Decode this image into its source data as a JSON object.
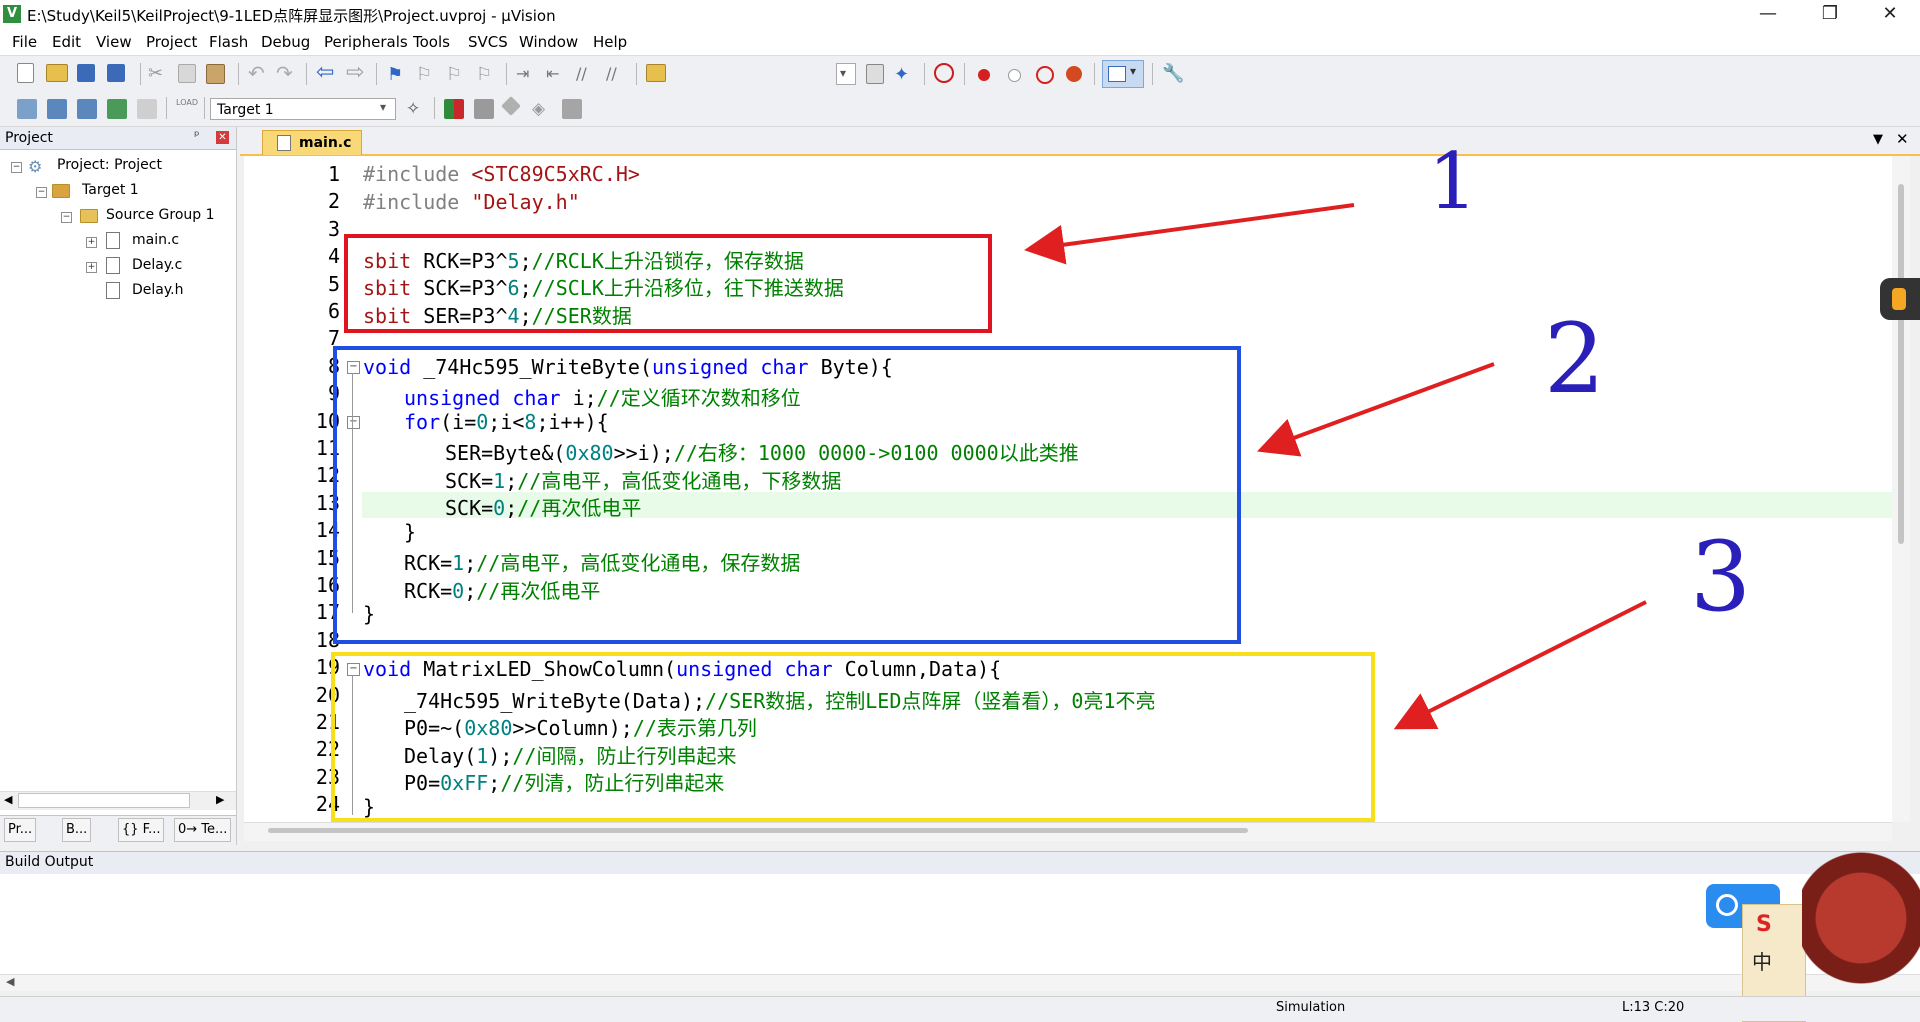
{
  "window": {
    "title": "E:\\Study\\Keil5\\KeilProject\\9-1LED点阵屏显示图形\\Project.uvproj - µVision",
    "app_icon": "V",
    "minimize_glyph": "—",
    "restore_glyph": "❐",
    "close_glyph": "✕"
  },
  "menu": [
    "File",
    "Edit",
    "View",
    "Project",
    "Flash",
    "Debug",
    "Peripherals",
    "Tools",
    "SVCS",
    "Window",
    "Help"
  ],
  "toolbar2": {
    "target": "Target 1",
    "load_label": "LOAD"
  },
  "project_panel": {
    "title": "Project",
    "pin_glyph": "ᵖ",
    "close_glyph": "✕",
    "tree": {
      "root": "Project: Project",
      "target": "Target 1",
      "group": "Source Group 1",
      "files": [
        "main.c",
        "Delay.c",
        "Delay.h"
      ]
    },
    "tabs": [
      "Pr...",
      "B...",
      "{} F...",
      "0→ Te..."
    ]
  },
  "editor": {
    "tab": "main.c",
    "line_numbers": [
      "1",
      "2",
      "3",
      "4",
      "5",
      "6",
      "7",
      "8",
      "9",
      "10",
      "11",
      "12",
      "13",
      "14",
      "15",
      "16",
      "17",
      "18",
      "19",
      "20",
      "21",
      "22",
      "23",
      "24"
    ]
  },
  "code": {
    "l1a": "#include ",
    "l1b": "<STC89C5xRC.H>",
    "l2a": "#include ",
    "l2b": "\"Delay.h\"",
    "l4a": "sbit ",
    "l4b": "RCK=P3^",
    "l4c": "5",
    "l4d": ";",
    "l4e": "//RCLK上升沿锁存，保存数据",
    "l5a": "sbit ",
    "l5b": "SCK=P3^",
    "l5c": "6",
    "l5d": ";",
    "l5e": "//SCLK上升沿移位，往下推送数据",
    "l6a": "sbit ",
    "l6b": "SER=P3^",
    "l6c": "4",
    "l6d": ";",
    "l6e": "//SER数据",
    "l8a": "void",
    "l8b": " _74Hc595_WriteByte(",
    "l8c": "unsigned char",
    "l8d": " Byte){",
    "l9a": "unsigned char",
    "l9b": " i;",
    "l9c": "//定义循环次数和移位",
    "l10a": "for",
    "l10b": "(i=",
    "l10c": "0",
    "l10d": ";i<",
    "l10e": "8",
    "l10f": ";i++){",
    "l11a": "SER=Byte&(",
    "l11b": "0x80",
    "l11c": ">>i);",
    "l11d": "//右移：1000 0000->0100 0000以此类推",
    "l12a": "SCK=",
    "l12b": "1",
    "l12c": ";",
    "l12d": "//高电平，高低变化通电，下移数据",
    "l13a": "SCK=",
    "l13b": "0",
    "l13c": ";",
    "l13d": "//再次低电平",
    "l14": "}",
    "l15a": "RCK=",
    "l15b": "1",
    "l15c": ";",
    "l15d": "//高电平，高低变化通电，保存数据",
    "l16a": "RCK=",
    "l16b": "0",
    "l16c": ";",
    "l16d": "//再次低电平",
    "l17": "}",
    "l19a": "void",
    "l19b": " MatrixLED_ShowColumn(",
    "l19c": "unsigned char",
    "l19d": " Column,Data){",
    "l20a": "_74Hc595_WriteByte(Data);",
    "l20b": "//SER数据，控制LED点阵屏（竖着看），0亮1不亮",
    "l21a": "P0=~(",
    "l21b": "0x80",
    "l21c": ">>Column);",
    "l21d": "//表示第几列",
    "l22a": "Delay(",
    "l22b": "1",
    "l22c": ");",
    "l22d": "//间隔，防止行列串起来",
    "l23a": "P0=",
    "l23b": "0xFF",
    "l23c": ";",
    "l23d": "//列清，防止行列串起来",
    "l24": "}"
  },
  "annotations": {
    "n1": "1",
    "n2": "2",
    "n3": "3"
  },
  "build_output": {
    "title": "Build Output"
  },
  "status": {
    "mode": "Simulation",
    "position": "L:13 C:20"
  },
  "colors": {
    "red_box": "#e0141e",
    "blue_box": "#1f4fe0",
    "yellow_box": "#f7e01a",
    "arrow": "#e02020",
    "number_ink": "#2a1fb8"
  }
}
